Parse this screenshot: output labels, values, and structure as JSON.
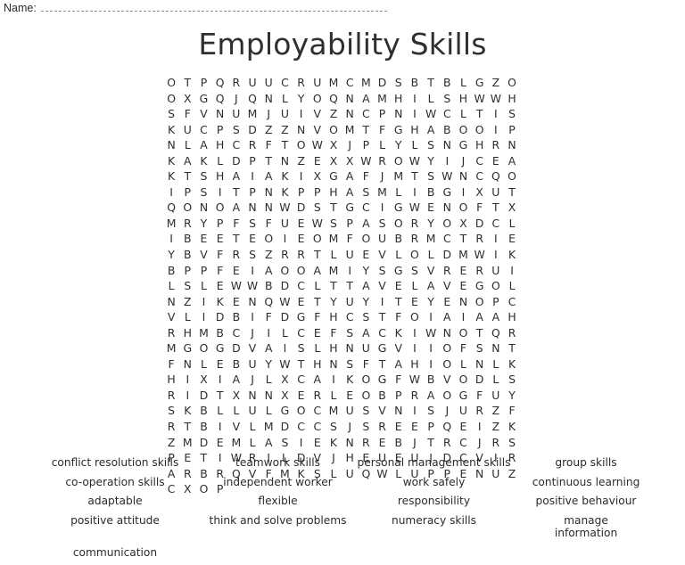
{
  "header": {
    "name_label": "Name:",
    "name_value": ""
  },
  "title": "Employability Skills",
  "grid": {
    "rows": 24,
    "cols": 22,
    "letters": [
      "O T P Q R U U C R U M C M D S B T B L G Z O O X",
      "G Q J Q N L Y O Q N A M H I L S H W W H S F V N",
      "U M J U I V Z N C P N I W C L T I S K U C P S D",
      "Z Z N V O M T F G H A B O O I P N L A H C R F T",
      "O W X J P L Y L S N G H R N K A K L D P T N Z E",
      "X X W R O W Y I J C E A K T S H A I A K I X G A",
      "F J M T S W N C Q O I P S I T P N K P P H A S M",
      "L I B G I X U T Q O N O A N N W D S T G C I G W",
      "E N O F T X M R Y P F S F U E W S P A S O R Y O",
      "X D C L I B E E T E O I E O M F O U B R M C T R",
      "I E Y B V F R S Z R R T L U E V L O L D M W I K",
      "B P P F E I A O O A M I Y S G S V R E R U I L S",
      "L E W W B D C L T T A V E L A V E G O L N Z I K",
      "E N Q W E T Y U Y I T E Y E N O P C V L I D B I",
      "F D G F H C S T F O I A I A A H R H M B C J I L",
      "C E F S A C K I W N O T Q R M G O G D V A I S L",
      "H N U G V I I O F S N T F N L E B U Y W T H N S",
      "F T A H I O L N L K H I X I A J L X C A I K O G",
      "F W B V O D L S R I D T X N N X E R L E O B P R",
      "A O G F U Y S K B L L U L G O C M U S V N I S J",
      "U R Z F R T B I V L M D C C S J S R E E P Q E I",
      "Z K Z M D E M L A S I E K N R E B J T R C J R S",
      "P E T I W R I L D V J H E U E U J D C V I R A R",
      "B R Q V F M K S L U Q W L U P P E N U Z C X O P"
    ]
  },
  "word_list": [
    "conflict resolution skills",
    "teamwork skills",
    "personal management skills",
    "group skills",
    "co-operation skills",
    "independent worker",
    "work safely",
    "continuous learning",
    "adaptable",
    "flexible",
    "responsibility",
    "positive behaviour",
    "positive attitude",
    "think and solve problems",
    "numeracy skills",
    "manage information",
    "communication"
  ]
}
